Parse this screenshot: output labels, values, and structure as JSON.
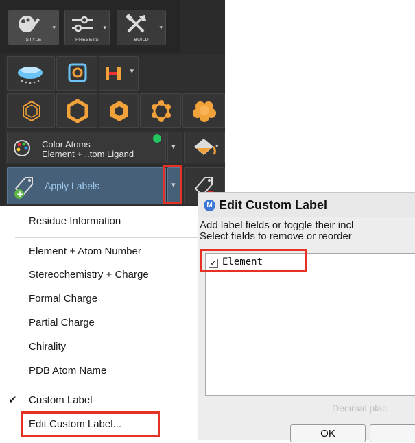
{
  "toolbar": {
    "style_label": "STYLE",
    "presets_label": "PRESETS",
    "build_label": "BUILD"
  },
  "color_row": {
    "line1": "Color Atoms",
    "line2": "Element + ..tom Ligand",
    "status_color": "#22c55e"
  },
  "labels_row": {
    "apply_label": "Apply Labels"
  },
  "menu": {
    "items": [
      {
        "label": "Residue Information"
      },
      {
        "label": "Element + Atom Number"
      },
      {
        "label": "Stereochemistry + Charge"
      },
      {
        "label": "Formal Charge"
      },
      {
        "label": "Partial Charge"
      },
      {
        "label": "Chirality"
      },
      {
        "label": "PDB Atom Name"
      },
      {
        "label": "Custom Label",
        "check": "✔"
      },
      {
        "label": "Edit Custom Label..."
      }
    ]
  },
  "dialog": {
    "icon_letter": "M",
    "title": "Edit Custom Label",
    "desc1": "Add label fields or toggle their incl",
    "desc2": "Select fields to remove or reorder",
    "field_check": "✓",
    "field_name": "Element",
    "decimal_label": "Decimal plac",
    "ok_label": "OK"
  },
  "colors": {
    "highlight": "#e63224",
    "accent_orange": "#f2a23a",
    "toolbar_bg": "#2b2b2b"
  }
}
